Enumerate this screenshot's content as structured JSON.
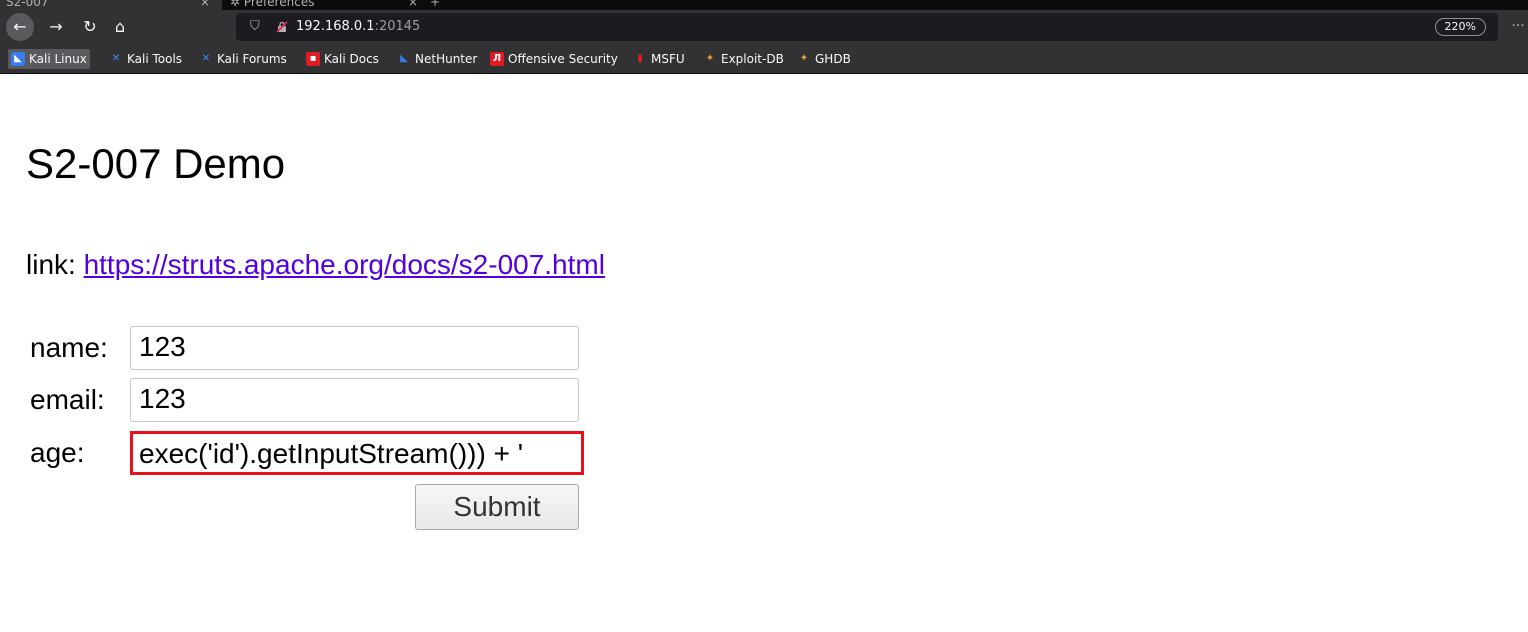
{
  "browser": {
    "tabs": [
      {
        "label": "S2-007",
        "close": "×"
      },
      {
        "label": "Preferences",
        "close": "×"
      }
    ],
    "new_tab": "+",
    "nav": {
      "back": "←",
      "forward": "→",
      "reload": "↻",
      "home": "⌂"
    },
    "url": {
      "host": "192.168.0.1",
      "port": ":20145"
    },
    "zoom": "220%",
    "more": "···",
    "bookmarks": [
      {
        "label": "Kali Linux",
        "icon": "kali-icon",
        "color": "#367bf0"
      },
      {
        "label": "Kali Tools",
        "icon": "kali-tools-icon",
        "color": "#3e8ef7"
      },
      {
        "label": "Kali Forums",
        "icon": "kali-forums-icon",
        "color": "#3e8ef7"
      },
      {
        "label": "Kali Docs",
        "icon": "kali-docs-icon",
        "color": "#e01b24"
      },
      {
        "label": "NetHunter",
        "icon": "nethunter-icon",
        "color": "#367bf0"
      },
      {
        "label": "Offensive Security",
        "icon": "offsec-icon",
        "color": "#e01b24"
      },
      {
        "label": "MSFU",
        "icon": "msfu-icon",
        "color": "#e01b24"
      },
      {
        "label": "Exploit-DB",
        "icon": "exploit-db-icon",
        "color": "#f0a030"
      },
      {
        "label": "GHDB",
        "icon": "ghdb-icon",
        "color": "#f0a030"
      }
    ]
  },
  "page": {
    "title": "S2-007 Demo",
    "link_label": "link: ",
    "link_url": "https://struts.apache.org/docs/s2-007.html",
    "form": {
      "name_label": "name:",
      "name_value": "123",
      "email_label": "email:",
      "email_value": "123",
      "age_label": "age:",
      "age_value": "exec('id').getInputStream())) + '",
      "submit_label": "Submit"
    }
  },
  "colors": {
    "link": "#5200e0",
    "highlight_border": "#e8101b",
    "toolbar": "#323234"
  }
}
